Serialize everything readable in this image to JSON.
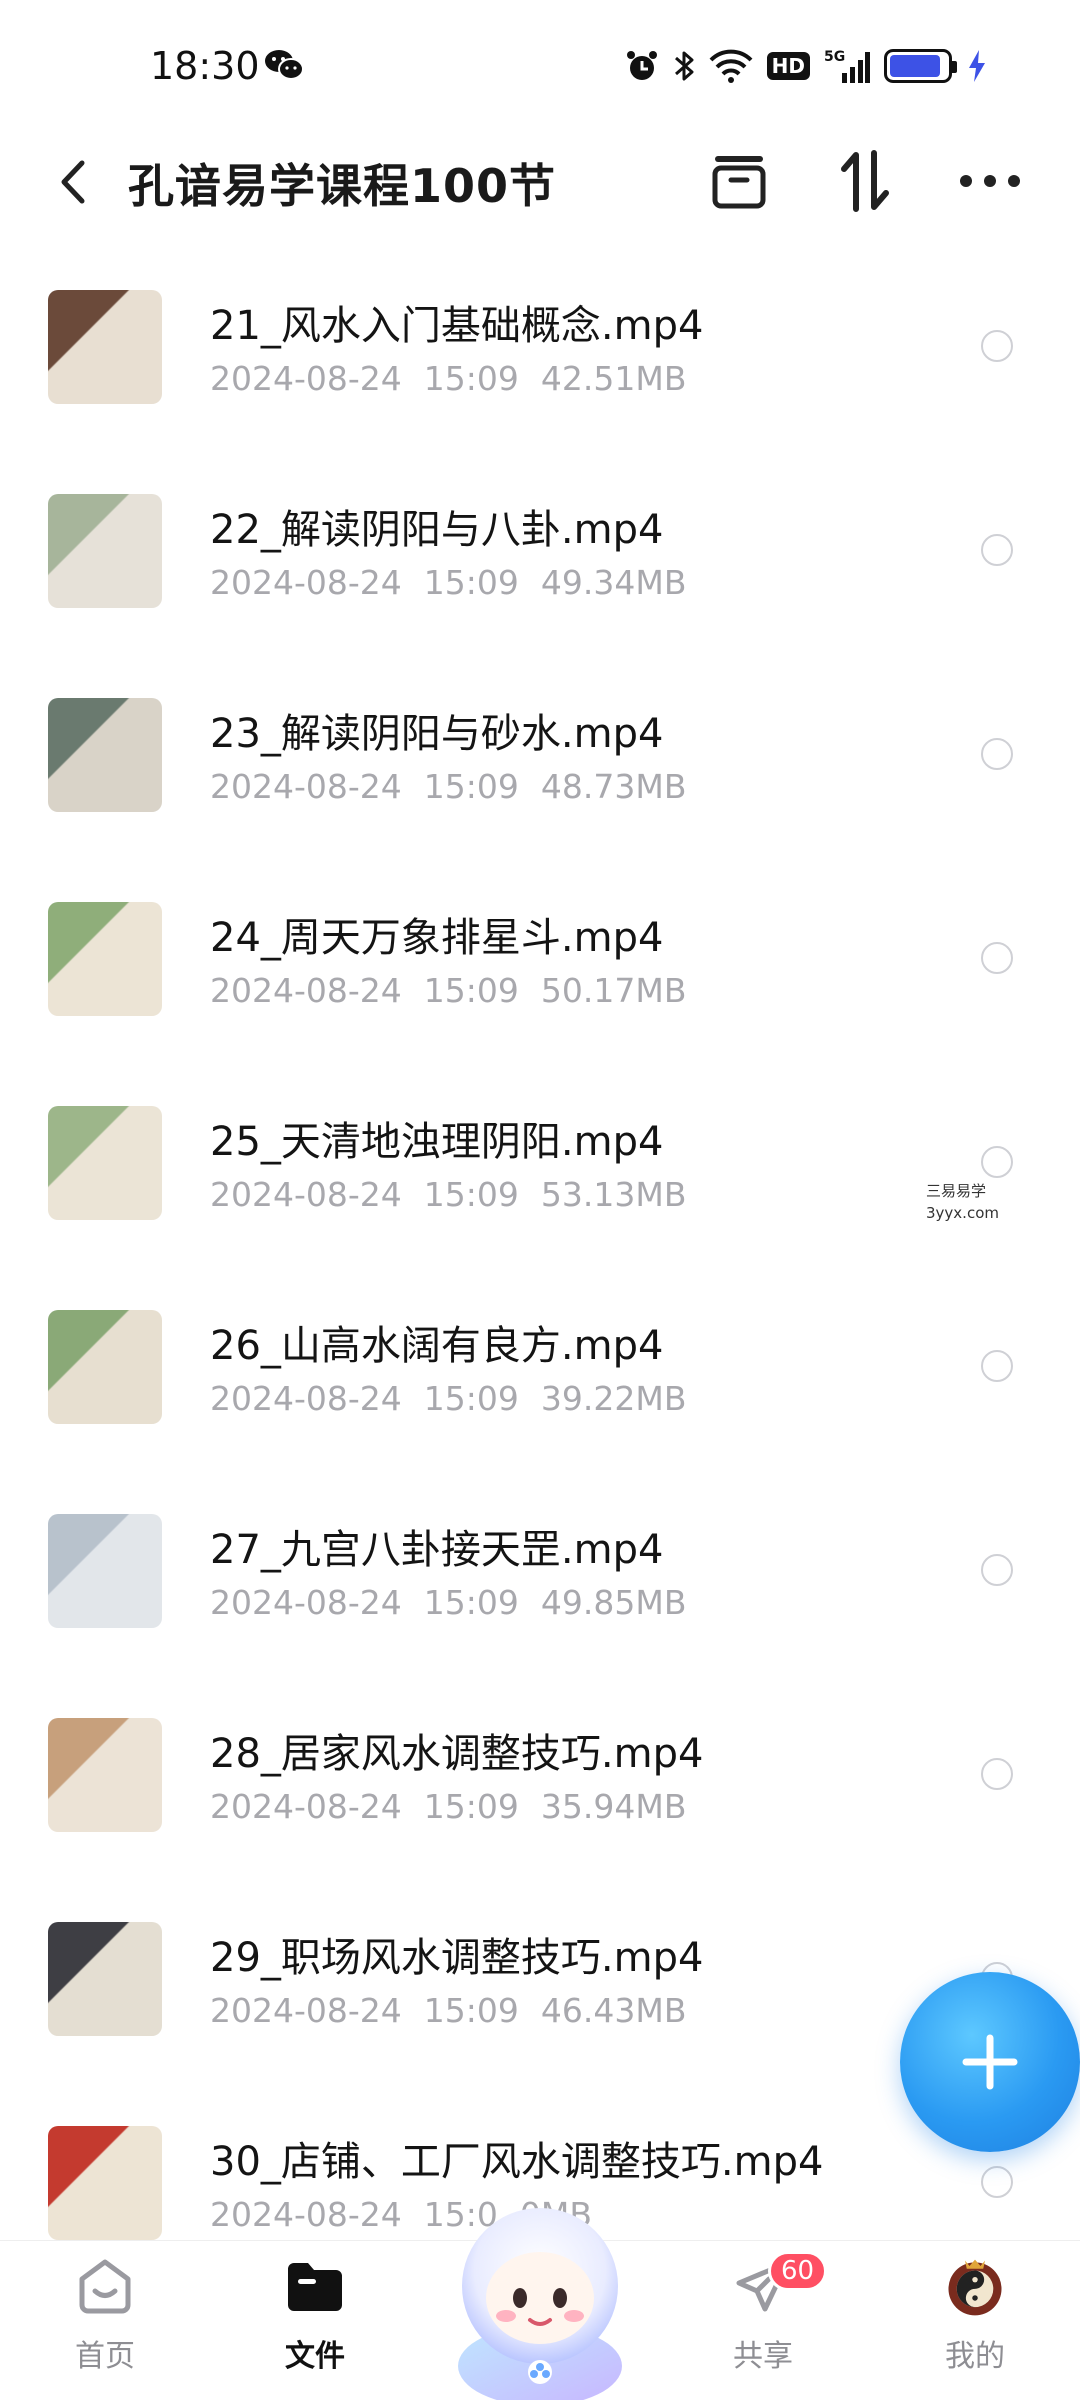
{
  "status": {
    "time": "18:30",
    "hd": "HD",
    "network": "5G",
    "battery_level": 0.9,
    "battery_color": "#3d52e6",
    "charging_color": "#3d52e6"
  },
  "header": {
    "title": "孔谙易学课程100节"
  },
  "files": [
    {
      "name": "21_风水入门基础概念.mp4",
      "date": "2024-08-24",
      "time": "15:09",
      "size": "42.51MB",
      "thumb": [
        "#6b4a3a",
        "#e8dfd2"
      ]
    },
    {
      "name": "22_解读阴阳与八卦.mp4",
      "date": "2024-08-24",
      "time": "15:09",
      "size": "49.34MB",
      "thumb": [
        "#a7b59b",
        "#e6e1d8"
      ]
    },
    {
      "name": "23_解读阴阳与砂水.mp4",
      "date": "2024-08-24",
      "time": "15:09",
      "size": "48.73MB",
      "thumb": [
        "#6a7a6f",
        "#d9d3c8"
      ]
    },
    {
      "name": "24_周天万象排星斗.mp4",
      "date": "2024-08-24",
      "time": "15:09",
      "size": "50.17MB",
      "thumb": [
        "#8fae7a",
        "#ece4d5"
      ]
    },
    {
      "name": "25_天清地浊理阴阳.mp4",
      "date": "2024-08-24",
      "time": "15:09",
      "size": "53.13MB",
      "thumb": [
        "#9db68a",
        "#ebe4d6"
      ]
    },
    {
      "name": "26_山高水阔有良方.mp4",
      "date": "2024-08-24",
      "time": "15:09",
      "size": "39.22MB",
      "thumb": [
        "#8aa977",
        "#e7dfd0"
      ]
    },
    {
      "name": "27_九宫八卦接天罡.mp4",
      "date": "2024-08-24",
      "time": "15:09",
      "size": "49.85MB",
      "thumb": [
        "#b8c2cc",
        "#e2e6ea"
      ]
    },
    {
      "name": "28_居家风水调整技巧.mp4",
      "date": "2024-08-24",
      "time": "15:09",
      "size": "35.94MB",
      "thumb": [
        "#c7a07c",
        "#ece3d6"
      ]
    },
    {
      "name": "29_职场风水调整技巧.mp4",
      "date": "2024-08-24",
      "time": "15:09",
      "size": "46.43MB",
      "thumb": [
        "#3e3e44",
        "#e4ded2"
      ]
    },
    {
      "name": "30_店铺、工厂风水调整技巧.mp4",
      "date": "2024-08-24",
      "time": "15:0",
      "size": "0MB",
      "thumb": [
        "#c43a2f",
        "#ede4d4"
      ]
    }
  ],
  "watermark": {
    "line1": "三易易学",
    "line2": "3yyx.com"
  },
  "nav": {
    "home": "首页",
    "files": "文件",
    "share": "共享",
    "share_badge": "60",
    "mine": "我的"
  }
}
